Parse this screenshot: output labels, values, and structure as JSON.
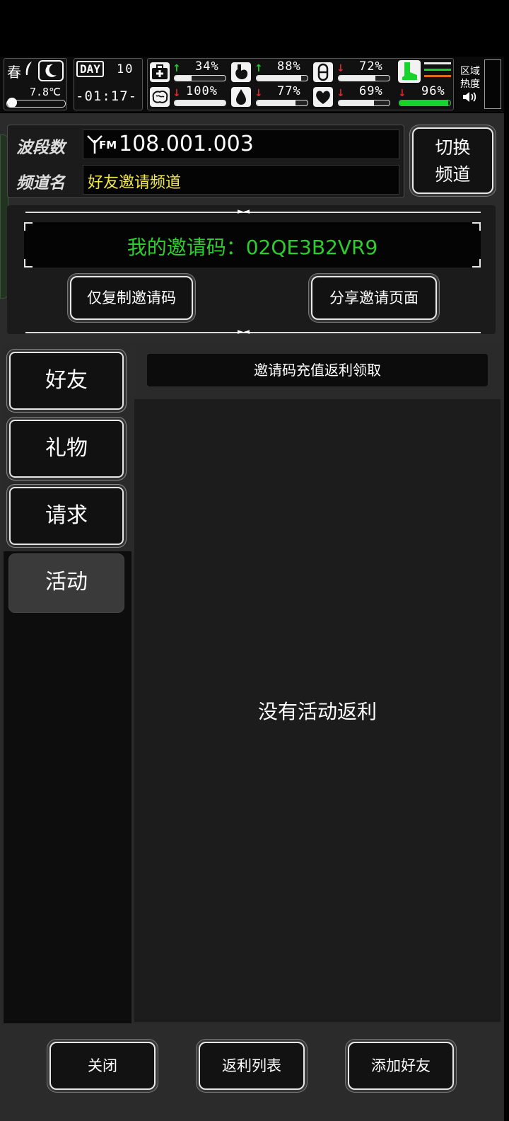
{
  "status": {
    "season": "春",
    "temperature": "7.8℃",
    "day_label": "DAY",
    "day_number": "10",
    "clock": "-01:17-",
    "stats": [
      {
        "name": "health",
        "icon": "medkit-icon",
        "trend": "up",
        "value": "34%",
        "level": 0.34
      },
      {
        "name": "hunger",
        "icon": "stomach-icon",
        "trend": "up",
        "value": "88%",
        "level": 0.88
      },
      {
        "name": "mood",
        "icon": "pill-icon",
        "trend": "down",
        "value": "72%",
        "level": 0.72
      },
      {
        "name": "brain",
        "icon": "brain-icon",
        "trend": "down",
        "value": "100%",
        "level": 1.0
      },
      {
        "name": "thirst",
        "icon": "water-drop-icon",
        "trend": "down",
        "value": "77%",
        "level": 0.77
      },
      {
        "name": "heart",
        "icon": "heart-icon",
        "trend": "down",
        "value": "69%",
        "level": 0.69
      },
      {
        "name": "stamina",
        "icon": "boot-icon",
        "trend": "down",
        "value": "96%",
        "level": 0.96
      }
    ],
    "zone_heat_line1": "区域",
    "zone_heat_line2": "热度",
    "colors": {
      "up": "#19d22b",
      "down": "#e0262a",
      "stamina": "#19d22b",
      "invite_code": "#2ecc2e",
      "channel_name": "#f1e84a"
    }
  },
  "radio": {
    "band_label": "波段数",
    "band_prefix": "FM",
    "band_value": "108.001.003",
    "channel_label": "频道名",
    "channel_value": "好友邀请频道",
    "switch_line1": "切换",
    "switch_line2": "频道"
  },
  "invite": {
    "code_text": "我的邀请码：02QE3B2VR9",
    "copy_button": "仅复制邀请码",
    "share_button": "分享邀请页面"
  },
  "tabs": [
    {
      "label": "好友",
      "active": false
    },
    {
      "label": "礼物",
      "active": false
    },
    {
      "label": "请求",
      "active": false
    },
    {
      "label": "活动",
      "active": true
    }
  ],
  "content": {
    "header": "邀请码充值返利领取",
    "empty_message": "没有活动返利"
  },
  "footer": {
    "close": "关闭",
    "rebate_list": "返利列表",
    "add_friend": "添加好友"
  }
}
